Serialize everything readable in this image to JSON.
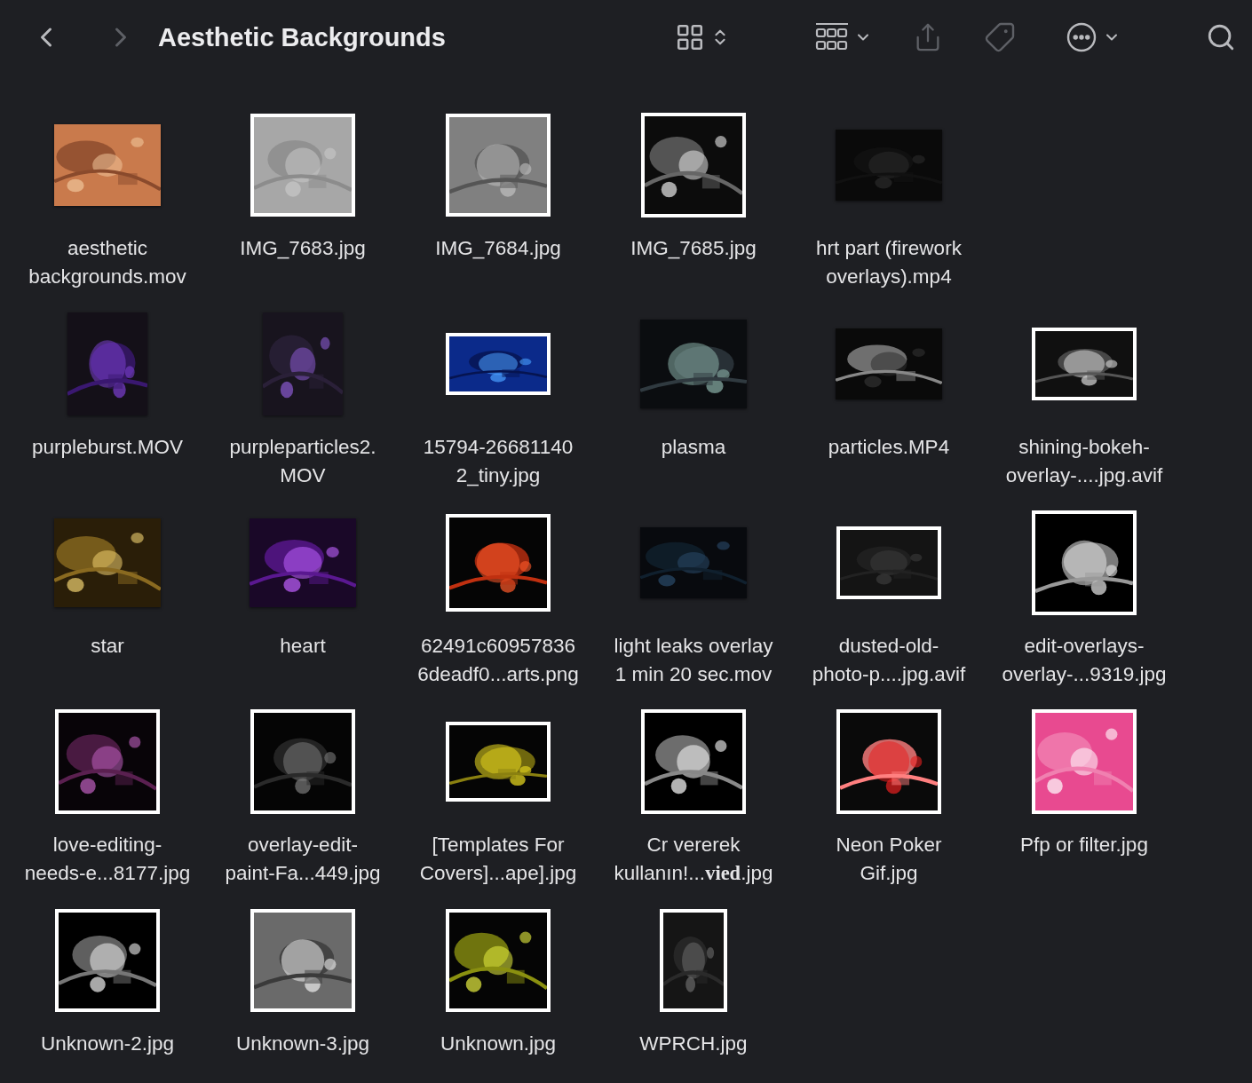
{
  "toolbar": {
    "title": "Aesthetic Backgrounds",
    "navigation": [
      {
        "kind": "back",
        "disabled": false
      },
      {
        "kind": "forward",
        "disabled": true
      }
    ],
    "actions": [
      {
        "kind": "view",
        "disabled": false
      },
      {
        "kind": "group",
        "disabled": false
      },
      {
        "kind": "share",
        "disabled": true
      },
      {
        "kind": "tag",
        "disabled": true
      },
      {
        "kind": "more",
        "disabled": false
      },
      {
        "kind": "search",
        "disabled": false
      }
    ]
  },
  "file_rows": [
    [
      {
        "name_lines": [
          "aesthetic",
          "backgrounds.mov"
        ]
      },
      {
        "name_lines": [
          "IMG_7683.jpg"
        ]
      },
      {
        "name_lines": [
          "IMG_7684.jpg"
        ]
      },
      {
        "name_lines": [
          "IMG_7685.jpg"
        ]
      },
      {
        "name_lines": [
          "hrt part (firework",
          "overlays).mp4"
        ]
      }
    ],
    [
      {
        "name_lines": [
          "purpleburst.MOV"
        ]
      },
      {
        "name_lines": [
          "purpleparticles2.",
          "MOV"
        ]
      },
      {
        "name_lines": [
          "15794-26681140",
          "2_tiny.jpg"
        ]
      },
      {
        "name_lines": [
          "plasma"
        ]
      },
      {
        "name_lines": [
          "particles.MP4"
        ]
      },
      {
        "name_lines": [
          "shining-bokeh-",
          "overlay-....jpg.avif"
        ]
      }
    ],
    [
      {
        "name_lines": [
          "star"
        ]
      },
      {
        "name_lines": [
          "heart"
        ]
      },
      {
        "name_lines": [
          "62491c60957836",
          "6deadf0...arts.png"
        ]
      },
      {
        "name_lines": [
          "light leaks overlay",
          "1 min 20 sec.mov"
        ]
      },
      {
        "name_lines": [
          "dusted-old-",
          "photo-p....jpg.avif"
        ]
      },
      {
        "name_lines": [
          "edit-overlays-",
          "overlay-...9319.jpg"
        ]
      }
    ],
    [
      {
        "name_lines": [
          "love-editing-",
          "needs-e...8177.jpg"
        ]
      },
      {
        "name_lines": [
          "overlay-edit-",
          "paint-Fa...449.jpg"
        ]
      },
      {
        "name_lines": [
          "[Templates For",
          "Covers]...ape].jpg"
        ]
      },
      {
        "name_lines": [
          "Cr vererek",
          "kullanın!...**vied**.jpg"
        ]
      },
      {
        "name_lines": [
          "Neon Poker",
          "Gif.jpg"
        ]
      },
      {
        "name_lines": [
          "Pfp or filter.jpg"
        ]
      }
    ],
    [
      {
        "name_lines": [
          "Unknown-2.jpg"
        ]
      },
      {
        "name_lines": [
          "Unknown-3.jpg"
        ]
      },
      {
        "name_lines": [
          "Unknown.jpg"
        ]
      },
      {
        "name_lines": [
          "WPRCH.jpg"
        ]
      }
    ]
  ]
}
